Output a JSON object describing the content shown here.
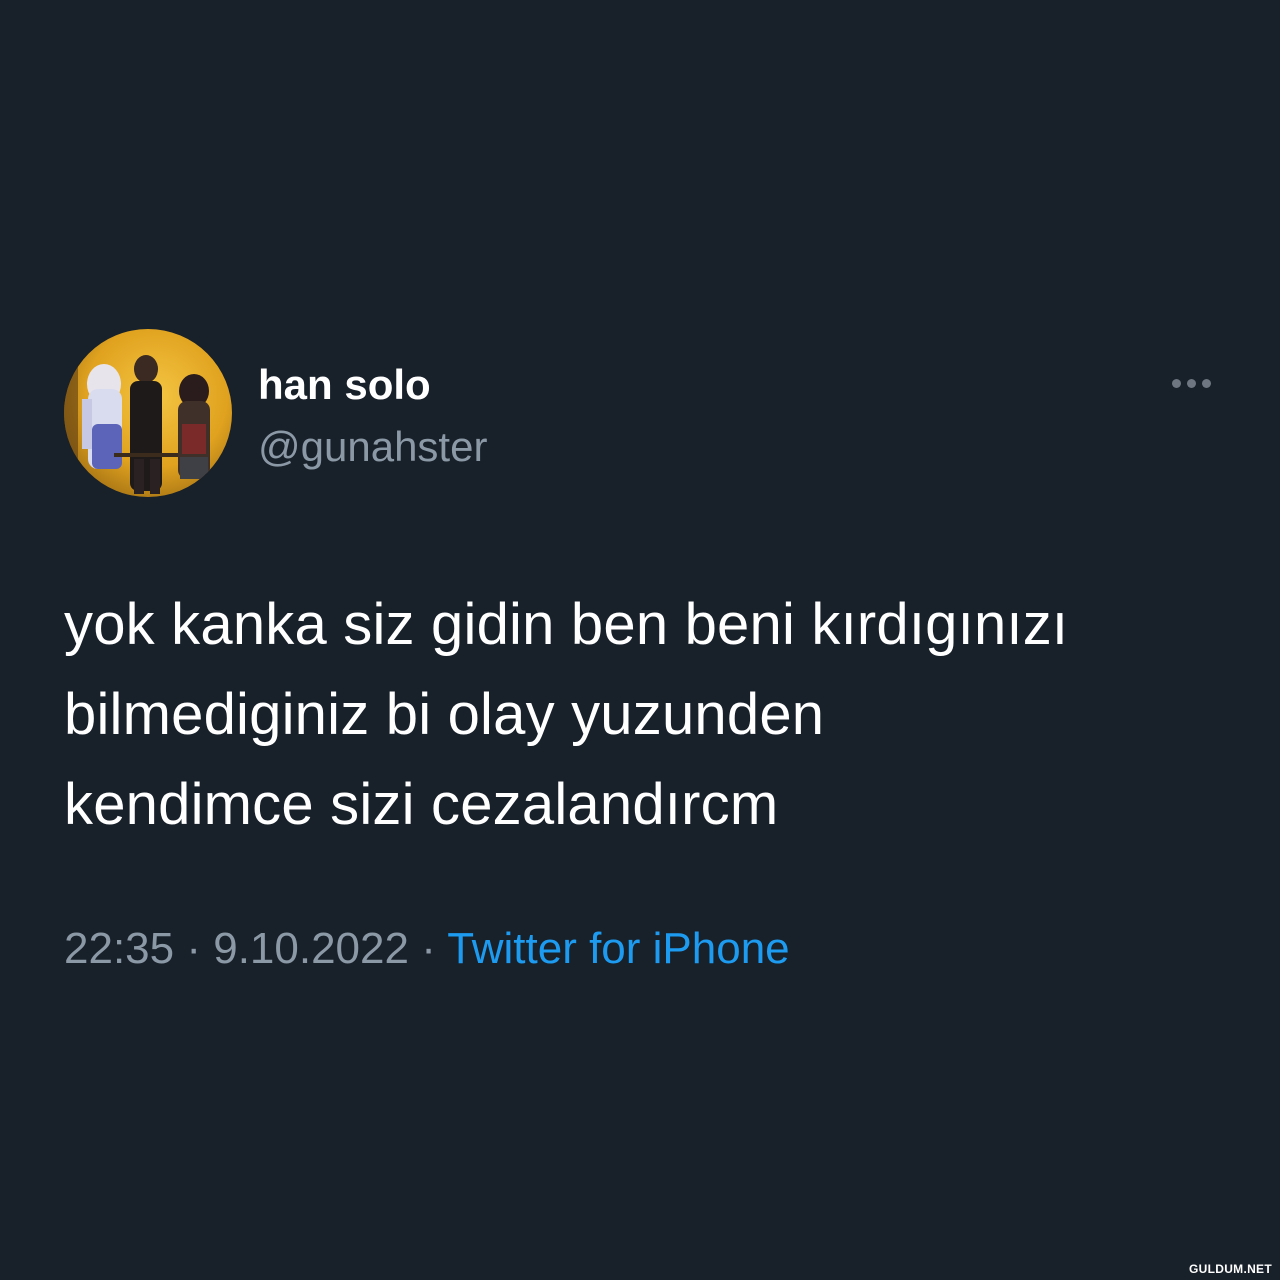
{
  "tweet": {
    "display_name": "han solo",
    "handle": "@gunahster",
    "text": "yok kanka siz gidin ben beni kırdıgınızı\nbilmediginiz bi olay yuzunden\nkendimce sizi cezalandırcm",
    "time": "22:35",
    "separator": " · ",
    "date": "9.10.2022",
    "source": "Twitter for iPhone",
    "more_icon": "ellipsis-icon"
  },
  "watermark": "GULDUM.NET",
  "colors": {
    "background": "#18202a",
    "text": "#ffffff",
    "secondary": "#8b98a5",
    "link": "#1d9bf0"
  }
}
